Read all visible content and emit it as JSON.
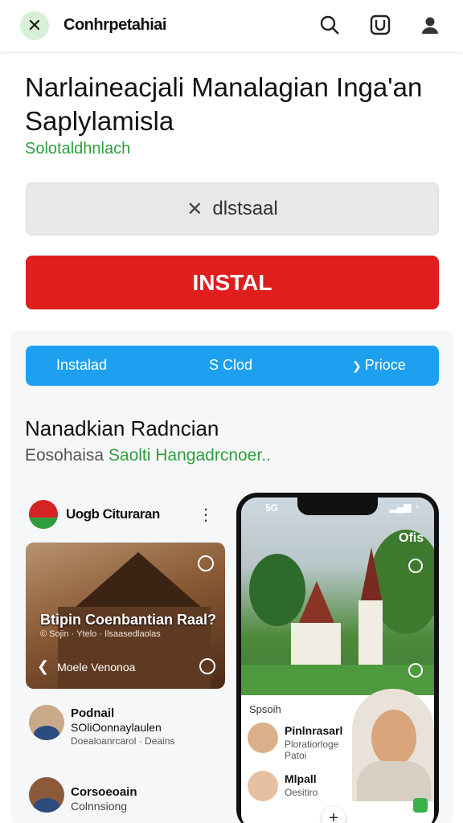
{
  "header": {
    "app_name": "Conhrpetahiai",
    "logo_glyph": "✕",
    "icons": [
      "search-icon",
      "u-square-icon",
      "account-icon"
    ]
  },
  "app": {
    "title": "Narlaineacjali Manalagian Inga'an Saplylamisla",
    "subtitle": "Solotaldhnlach"
  },
  "buttons": {
    "disable_label": "dlstsaal",
    "disable_glyph": "✕",
    "install_label": "INSTAL",
    "install_color": "#e01e1e"
  },
  "tabs": [
    {
      "label": "Instalad"
    },
    {
      "label": "S Clod"
    },
    {
      "label": "Prioce",
      "glyph": "❯"
    }
  ],
  "section": {
    "title": "Nanadkian Radncian",
    "subtitle_part1": "Eosohaisa ",
    "subtitle_part2": "Saolti Hangadrcnoer.."
  },
  "card": {
    "name": "Uogb Cituraran",
    "photo_title": "Btipin Coenbantian Raal?",
    "photo_meta": "© Sojin · Ytelo · Ilsaasedlaolas",
    "photo_footer": "Moele Venonoa",
    "people": [
      {
        "name": "Podnail",
        "role": "SOliOonnaylaulen",
        "meta": "Doealoanrcarol · Deains"
      },
      {
        "name": "Corsoeoain",
        "role": "Colnnsiong",
        "meta": ""
      }
    ]
  },
  "phone": {
    "status_left": "5G",
    "overlay_text": "Ofis",
    "label": "Spsoih",
    "people": [
      {
        "name": "Pinlnrasarl",
        "meta": "Ploratiorloge Patoi"
      },
      {
        "name": "Mlpall",
        "meta": "Oesitiro"
      }
    ],
    "fab_glyph": "+"
  }
}
